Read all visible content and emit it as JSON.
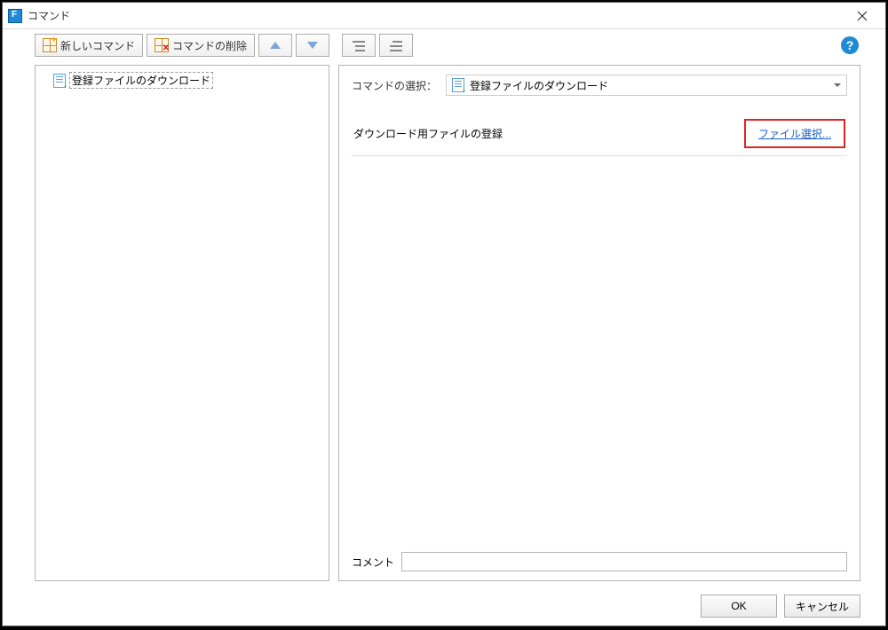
{
  "titlebar": {
    "title": "コマンド"
  },
  "toolbar": {
    "new_label": "新しいコマンド",
    "delete_label": "コマンドの削除"
  },
  "tree": {
    "items": [
      {
        "label": "登録ファイルのダウンロード"
      }
    ]
  },
  "right": {
    "select_label": "コマンドの選択：",
    "select_value": "登録ファイルのダウンロード",
    "section_label": "ダウンロード用ファイルの登録",
    "file_link": "ファイル選択...",
    "comment_label": "コメント",
    "comment_value": ""
  },
  "footer": {
    "ok": "OK",
    "cancel": "キャンセル"
  }
}
